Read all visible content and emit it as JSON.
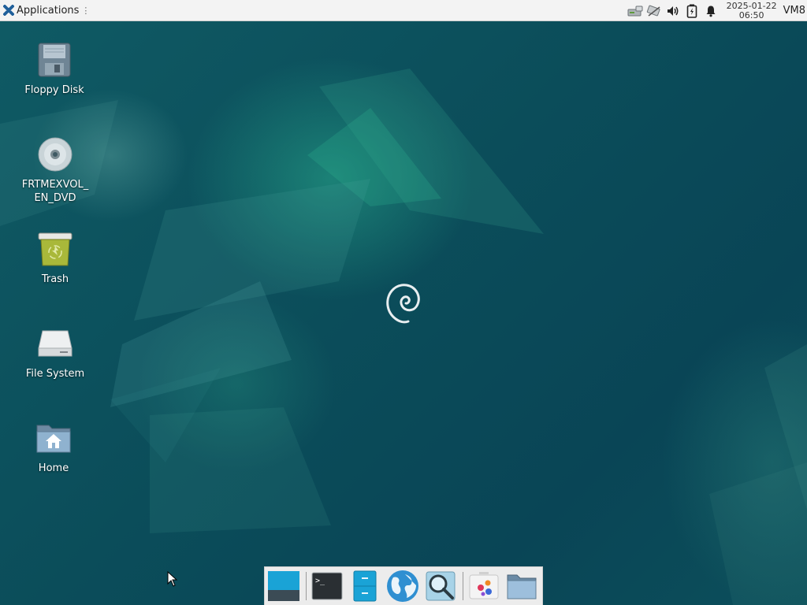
{
  "top_panel": {
    "applications_label": "Applications",
    "grip_glyph": "⋮",
    "tray_icons": [
      "network-wired-icon",
      "network-disconnected-icon",
      "volume-icon",
      "battery-icon",
      "notification-bell-icon"
    ],
    "clock_date": "2025-01-22",
    "clock_time": "06:50",
    "vm_name": "VM8"
  },
  "desktop": {
    "icons": [
      {
        "label": "Floppy Disk",
        "icon": "floppy-disk-icon"
      },
      {
        "label": "FRTMEXVOL_\nEN_DVD",
        "icon": "optical-disc-icon"
      },
      {
        "label": "Trash",
        "icon": "trash-icon"
      },
      {
        "label": "File System",
        "icon": "hard-drive-icon"
      },
      {
        "label": "Home",
        "icon": "home-folder-icon"
      }
    ]
  },
  "dock": {
    "items": [
      "show-desktop-icon",
      "terminal-icon",
      "file-manager-icon",
      "web-browser-icon",
      "app-finder-icon",
      "settings-icon",
      "folder-icon"
    ]
  },
  "colors": {
    "panel_bg": "#f3f3f3",
    "desktop_bg": "#0b4f5c",
    "accent": "#1aa3d6"
  }
}
